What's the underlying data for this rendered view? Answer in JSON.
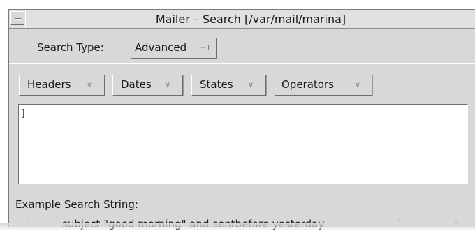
{
  "window": {
    "title": "Mailer – Search [/var/mail/marina]"
  },
  "search_type": {
    "label": "Search Type:",
    "value": "Advanced"
  },
  "menus": [
    {
      "label": "Headers"
    },
    {
      "label": "Dates"
    },
    {
      "label": "States"
    },
    {
      "label": "Operators"
    }
  ],
  "search_field": {
    "value": ""
  },
  "example": {
    "label": "Example Search String:",
    "text": "subject \"good morning\" and sentbefore yesterday"
  },
  "icons": {
    "window_menu": "window-menu-icon",
    "menu_indicator": "menu-triangle-icon",
    "option_indicator": "option-menu-icon",
    "text_cursor": "text-cursor-icon"
  },
  "colors": {
    "panel": "#d8d8d8",
    "text": "#1a1a1a",
    "field": "#ffffff"
  }
}
